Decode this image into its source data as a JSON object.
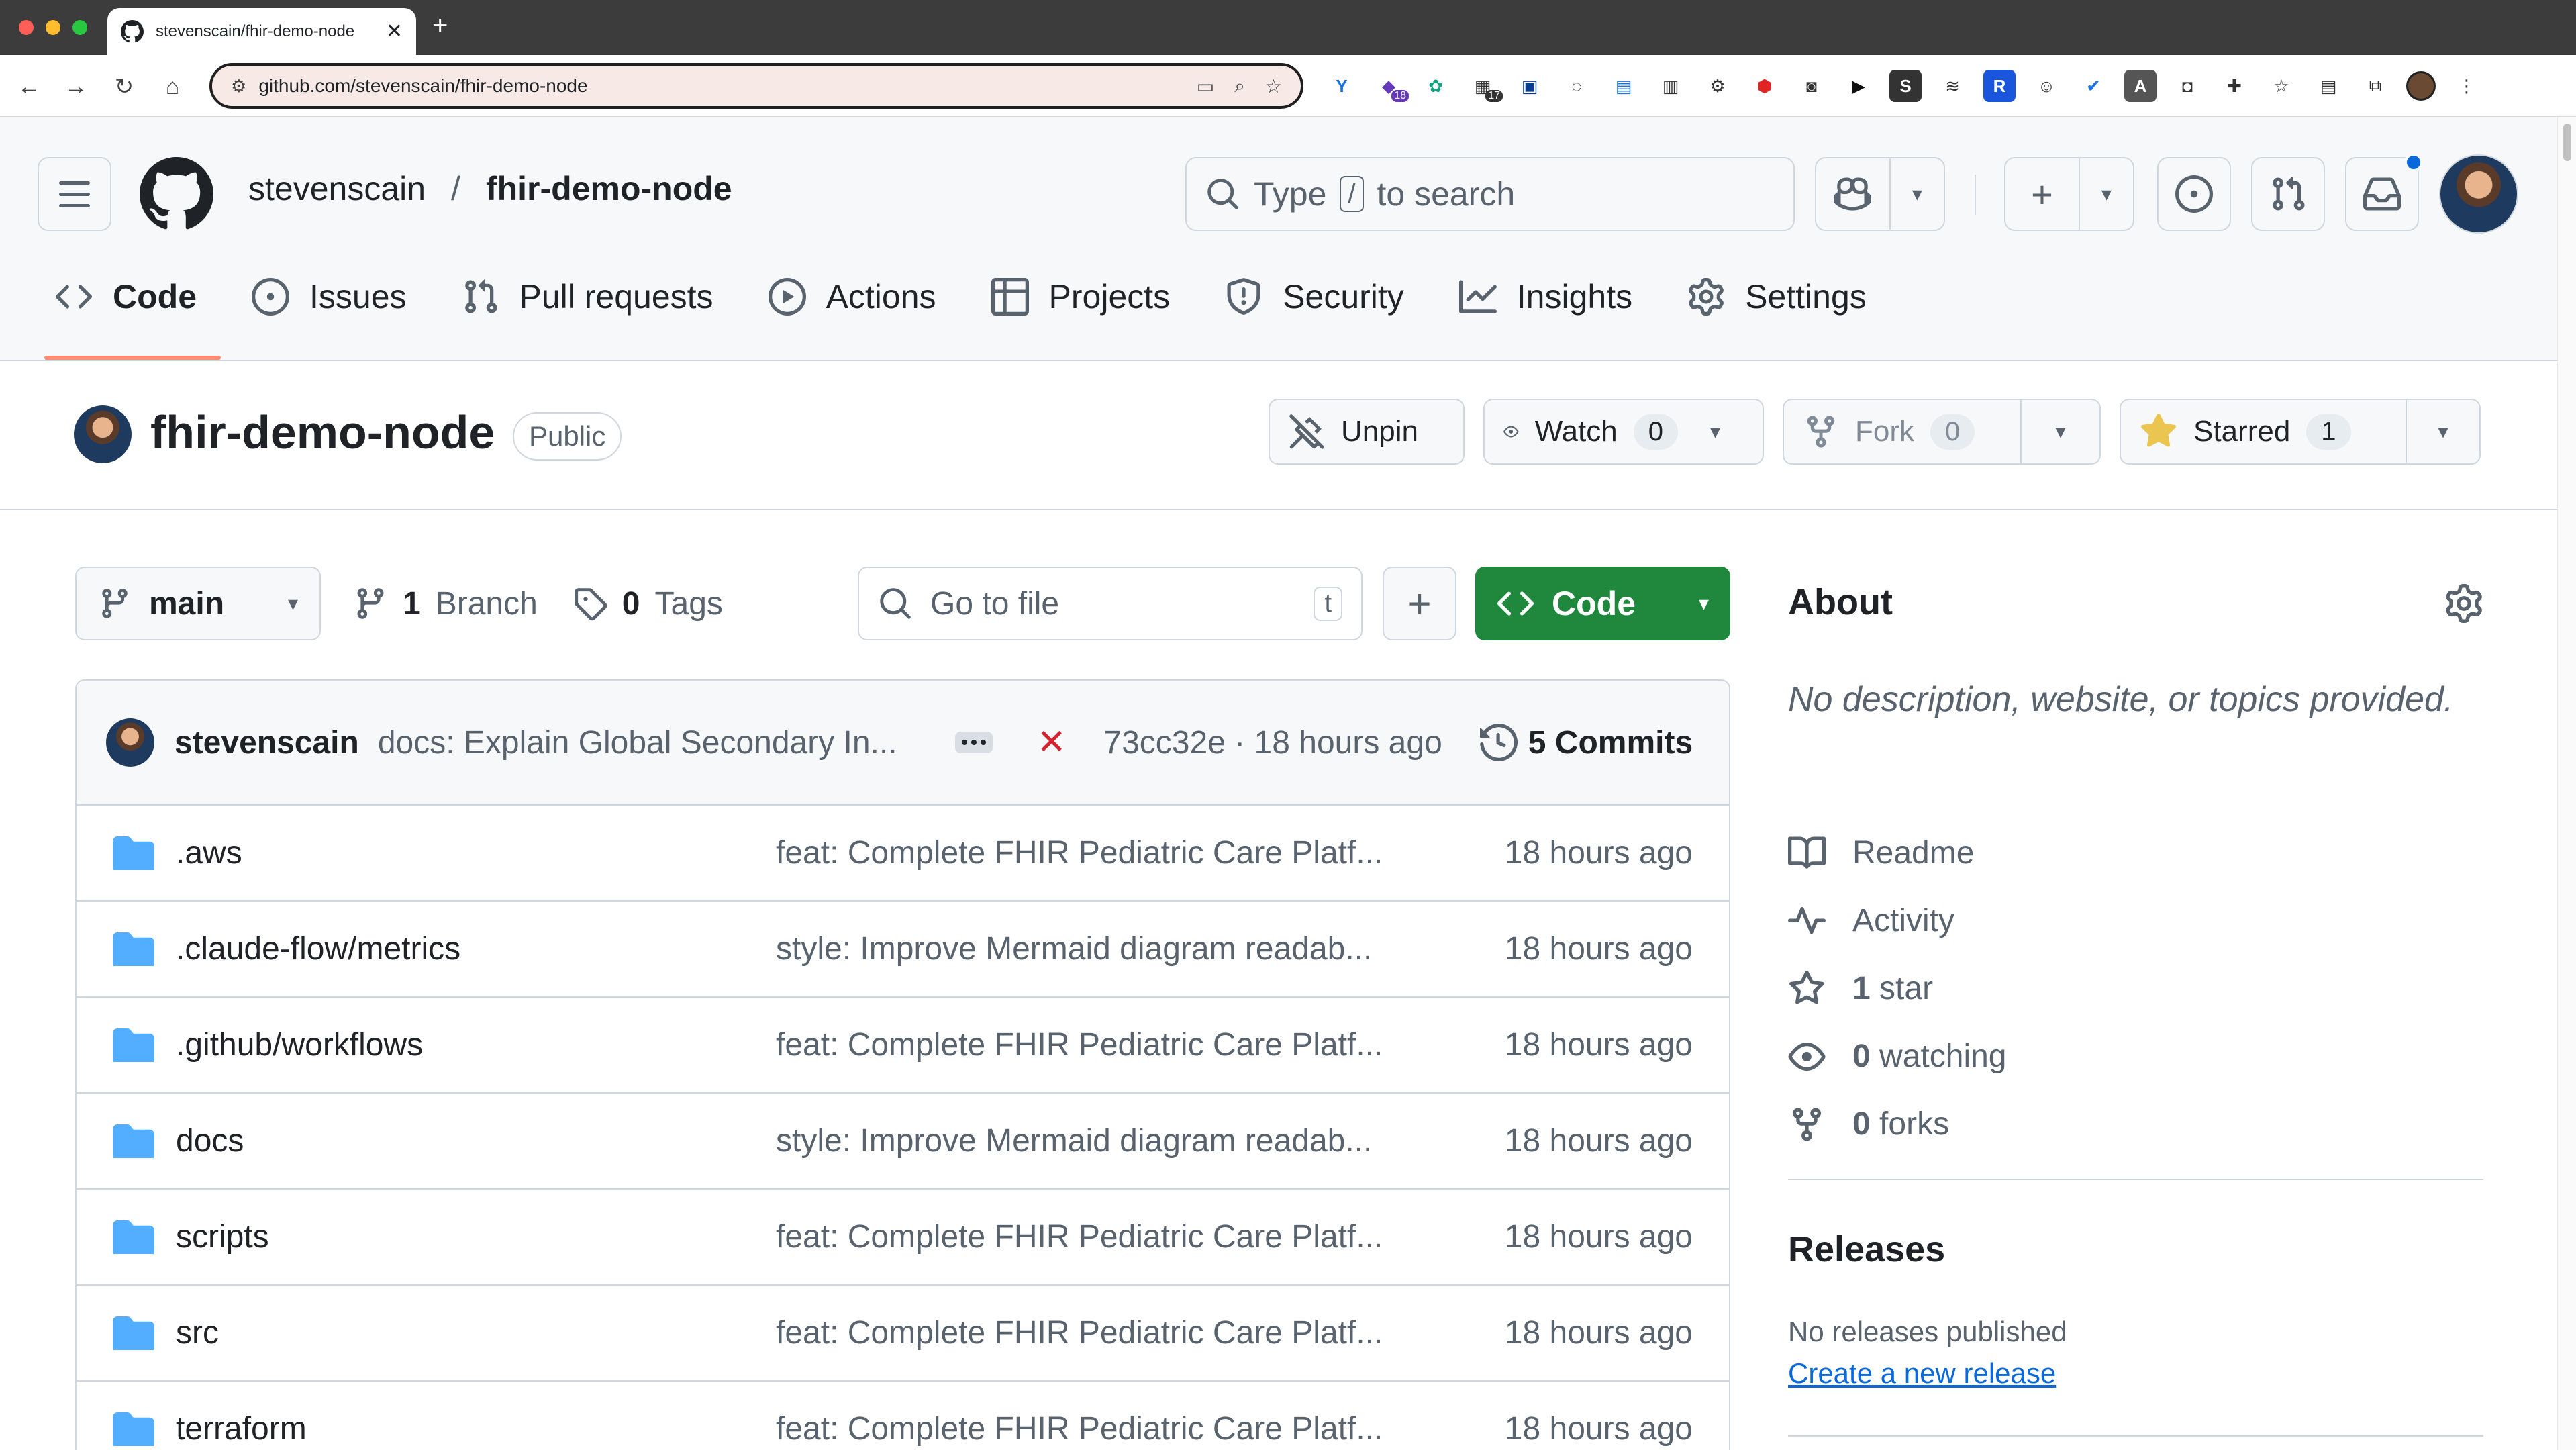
{
  "browser": {
    "tab_title": "stevenscain/fhir-demo-node",
    "url": "github.com/stevenscain/fhir-demo-node",
    "new_tab": "+",
    "close": "✕",
    "ext_badges": [
      "18",
      "17"
    ]
  },
  "header": {
    "owner": "stevenscain",
    "slash": "/",
    "repo": "fhir-demo-node",
    "search_type": "Type",
    "search_key": "/",
    "search_rest": "to search"
  },
  "repo_tabs": [
    {
      "label": "Code",
      "icon": "code-icon"
    },
    {
      "label": "Issues",
      "icon": "issue-icon"
    },
    {
      "label": "Pull requests",
      "icon": "pull-request-icon"
    },
    {
      "label": "Actions",
      "icon": "play-icon"
    },
    {
      "label": "Projects",
      "icon": "table-icon"
    },
    {
      "label": "Security",
      "icon": "shield-icon"
    },
    {
      "label": "Insights",
      "icon": "graph-icon"
    },
    {
      "label": "Settings",
      "icon": "gear-icon"
    }
  ],
  "title_row": {
    "name": "fhir-demo-node",
    "visibility": "Public",
    "unpin": "Unpin",
    "watch": "Watch",
    "watch_count": "0",
    "fork": "Fork",
    "fork_count": "0",
    "starred": "Starred",
    "star_count": "1"
  },
  "file_toolbar": {
    "branch": "main",
    "branch_count": "1",
    "branch_label": "Branch",
    "tag_count": "0",
    "tag_label": "Tags",
    "go_to_file": "Go to file",
    "go_to_file_key": "t",
    "code_button": "Code"
  },
  "latest_commit": {
    "author": "stevenscain",
    "message": "docs: Explain Global Secondary In...",
    "status": "✕",
    "hash_time": "73cc32e · 18 hours ago",
    "commits": "5 Commits"
  },
  "files": [
    {
      "name": ".aws",
      "commit": "feat: Complete FHIR Pediatric Care Platf...",
      "time": "18 hours ago"
    },
    {
      "name": ".claude-flow/metrics",
      "commit": "style: Improve Mermaid diagram readab...",
      "time": "18 hours ago"
    },
    {
      "name": ".github/workflows",
      "commit": "feat: Complete FHIR Pediatric Care Platf...",
      "time": "18 hours ago"
    },
    {
      "name": "docs",
      "commit": "style: Improve Mermaid diagram readab...",
      "time": "18 hours ago"
    },
    {
      "name": "scripts",
      "commit": "feat: Complete FHIR Pediatric Care Platf...",
      "time": "18 hours ago"
    },
    {
      "name": "src",
      "commit": "feat: Complete FHIR Pediatric Care Platf...",
      "time": "18 hours ago"
    },
    {
      "name": "terraform",
      "commit": "feat: Complete FHIR Pediatric Care Platf...",
      "time": "18 hours ago"
    }
  ],
  "about": {
    "title": "About",
    "description": "No description, website, or topics provided.",
    "readme": "Readme",
    "activity": "Activity",
    "stars_count": "1",
    "stars_label": "star",
    "watching_count": "0",
    "watching_label": "watching",
    "forks_count": "0",
    "forks_label": "forks"
  },
  "releases": {
    "title": "Releases",
    "none": "No releases published",
    "create": "Create a new release"
  },
  "colors": {
    "accent_green": "#1f883d",
    "link_blue": "#0969da",
    "tab_underline": "#fd8c73",
    "folder_blue": "#54aeff",
    "error_red": "#d1242f"
  }
}
